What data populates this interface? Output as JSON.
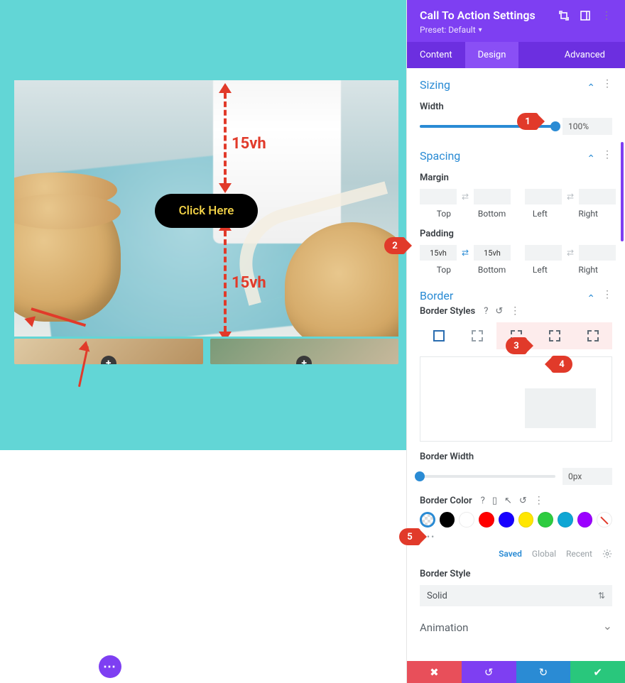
{
  "canvas": {
    "cta_button_label": "Click Here",
    "measure_label_top": "15vh",
    "measure_label_bottom": "15vh"
  },
  "callouts": {
    "c1": "1",
    "c2": "2",
    "c3": "3",
    "c4": "4",
    "c5": "5"
  },
  "panel": {
    "title": "Call To Action Settings",
    "preset_label": "Preset: Default",
    "tabs": {
      "content": "Content",
      "design": "Design",
      "advanced": "Advanced"
    }
  },
  "sizing": {
    "section_title": "Sizing",
    "width_label": "Width",
    "width_value": "100%",
    "width_percent": 100
  },
  "spacing": {
    "section_title": "Spacing",
    "margin_label": "Margin",
    "padding_label": "Padding",
    "sides": {
      "top": "Top",
      "bottom": "Bottom",
      "left": "Left",
      "right": "Right"
    },
    "margin": {
      "top": "",
      "bottom": "",
      "left": "",
      "right": ""
    },
    "padding": {
      "top": "15vh",
      "bottom": "15vh",
      "left": "",
      "right": ""
    },
    "padding_linked_vertical": true
  },
  "border": {
    "section_title": "Border",
    "styles_label": "Border Styles",
    "width_label": "Border Width",
    "width_value": "0px",
    "width_percent": 0,
    "color_label": "Border Color",
    "style_label": "Border Style",
    "style_value": "Solid",
    "palette_tabs": {
      "saved": "Saved",
      "global": "Global",
      "recent": "Recent"
    },
    "swatches": [
      "transparent",
      "#000000",
      "#ffffff",
      "#ff0000",
      "#1700ff",
      "#ffe600",
      "#2ecc40",
      "#0fa6d4",
      "#9b00ff",
      "none"
    ]
  },
  "animation": {
    "section_title": "Animation"
  }
}
